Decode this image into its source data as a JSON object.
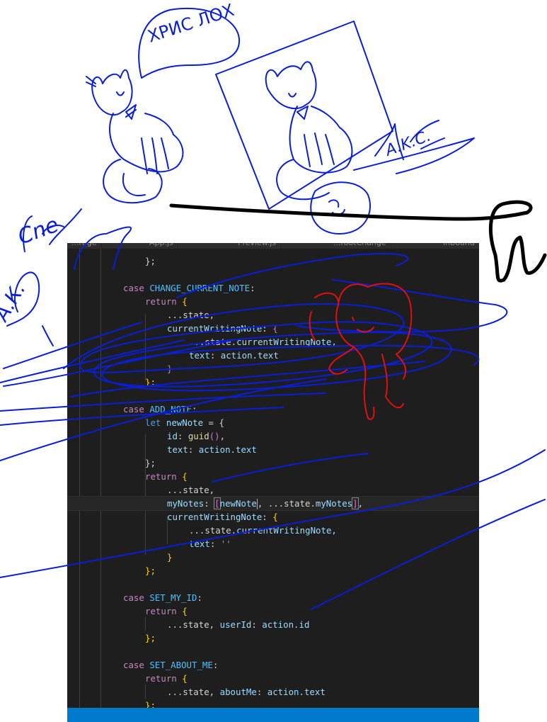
{
  "tabs": [
    "...rage",
    "App.js",
    "Preview.js",
    "...rootChange",
    "Inbound"
  ],
  "annotations": {
    "speech_bubble": "ХРИС ЛОХ",
    "scribble_left_top": "Cne",
    "scribble_left_mid": "А.К.",
    "scribble_right": "A.K.C."
  },
  "code": {
    "l1": "};",
    "c1_kw": "case",
    "c1_name": "CHANGE_CURRENT_NOTE",
    "l3_kw": "return",
    "l3_br": "{",
    "l4": "...state,",
    "l5_key": "currentWritingNote",
    "l5_br": "{",
    "l6_spread": "...state.",
    "l6_prop": "currentWritingNote,",
    "l7_key": "text",
    "l7_val": "action.text",
    "l8": "}",
    "l9": "};",
    "c2_kw": "case",
    "c2_name": "ADD_NOTE",
    "l11_kw": "let",
    "l11_var": "newNote",
    "l11_rest": " = {",
    "l12_key": "id",
    "l12_fn": "guid",
    "l12_paren": "()",
    "l13_key": "text",
    "l13_val": "action.text",
    "l14": "};",
    "l15_kw": "return",
    "l15_br": "{",
    "l16": "...state,",
    "l17_key": "myNotes",
    "l17_lb": "[",
    "l17_a": "newNote",
    "l17_b": ", ...state.",
    "l17_c": "myNotes",
    "l17_rb": "]",
    "l17_comma": ",",
    "l18_key": "currentWritingNote",
    "l18_br": "{",
    "l19_a": "...state.",
    "l19_b": "currentWritingNote,",
    "l20_key": "text",
    "l20_val": "''",
    "l21": "}",
    "l22": "};",
    "c3_kw": "case",
    "c3_name": "SET_MY_ID",
    "l25_kw": "return",
    "l25_br": "{",
    "l26_a": "...state, ",
    "l26_key": "userId",
    "l26_val": "action.id",
    "l27": "};",
    "c4_kw": "case",
    "c4_name": "SET_ABOUT_ME",
    "l30_kw": "return",
    "l30_br": "{",
    "l31_a": "...state, ",
    "l31_key": "aboutMe",
    "l31_val": "action.text",
    "l32": "};"
  },
  "colors": {
    "editor_bg": "#1e1e1e",
    "ink_blue": "#0a1ed6",
    "ink_red": "#e01010",
    "ink_black": "#000000",
    "status_bar": "#007acc"
  }
}
